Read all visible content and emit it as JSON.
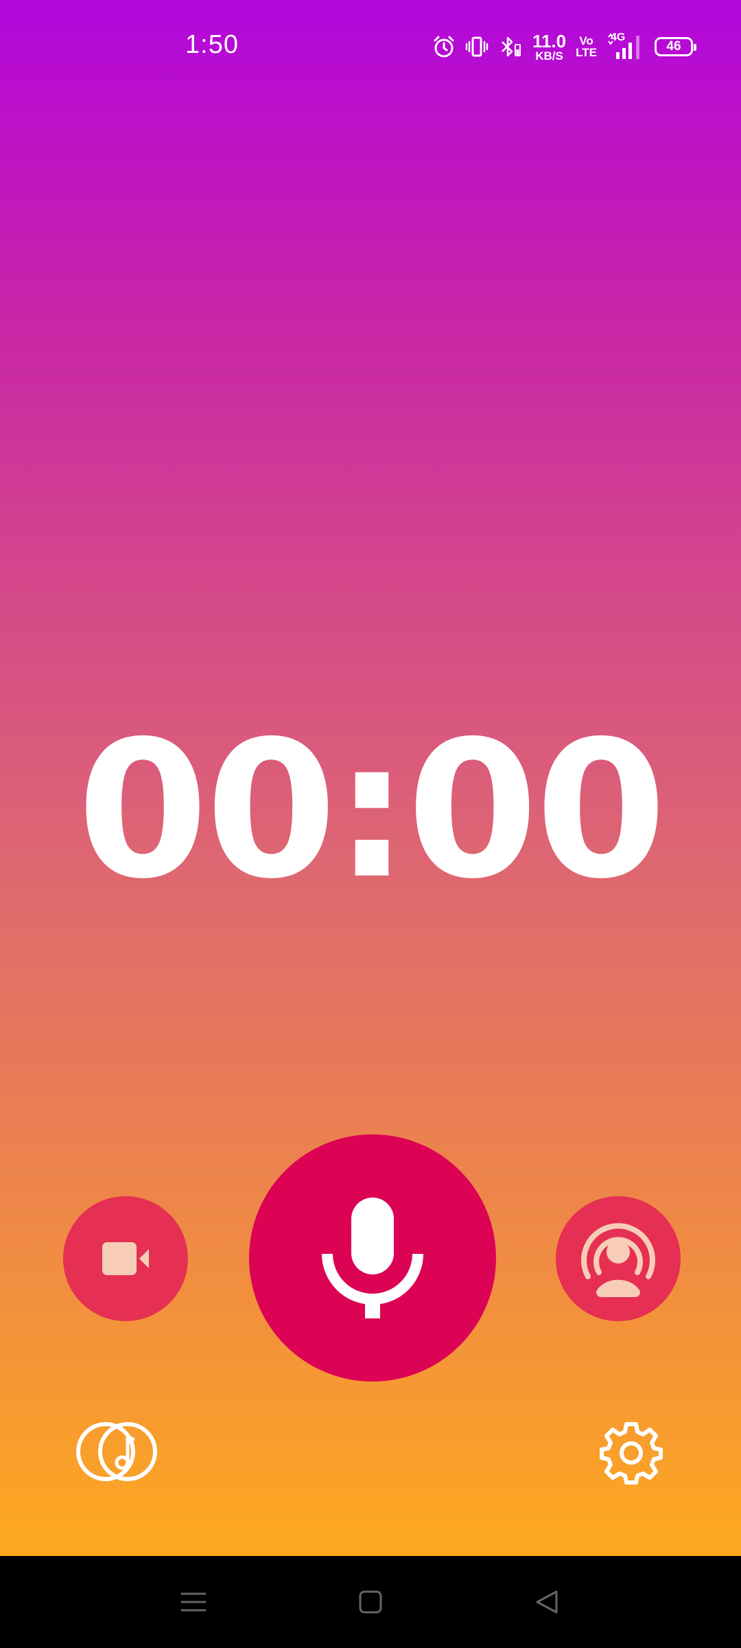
{
  "status_bar": {
    "time": "1:50",
    "net_speed_value": "11.0",
    "net_speed_unit": "KB/S",
    "volte_top": "Vo",
    "volte_bottom": "LTE",
    "network_type": "4G",
    "battery_level": "46",
    "icons": [
      "alarm-icon",
      "vibrate-icon",
      "bluetooth-icon",
      "signal-icon",
      "battery-icon"
    ]
  },
  "recorder": {
    "timer": "00:00"
  },
  "controls": {
    "left": "video-camera-icon",
    "center": "microphone-icon",
    "right": "live-stream-icon",
    "bottom_left": "music-icon",
    "bottom_right": "gear-icon"
  },
  "navigation": [
    "menu-icon",
    "home-icon",
    "back-icon"
  ],
  "colors": {
    "gradient_top": "#b306dc",
    "gradient_bottom": "#fda91f",
    "record_button": "#dc0354",
    "side_buttons": "#e52f53",
    "icon_fill": "#f7cdb8"
  }
}
